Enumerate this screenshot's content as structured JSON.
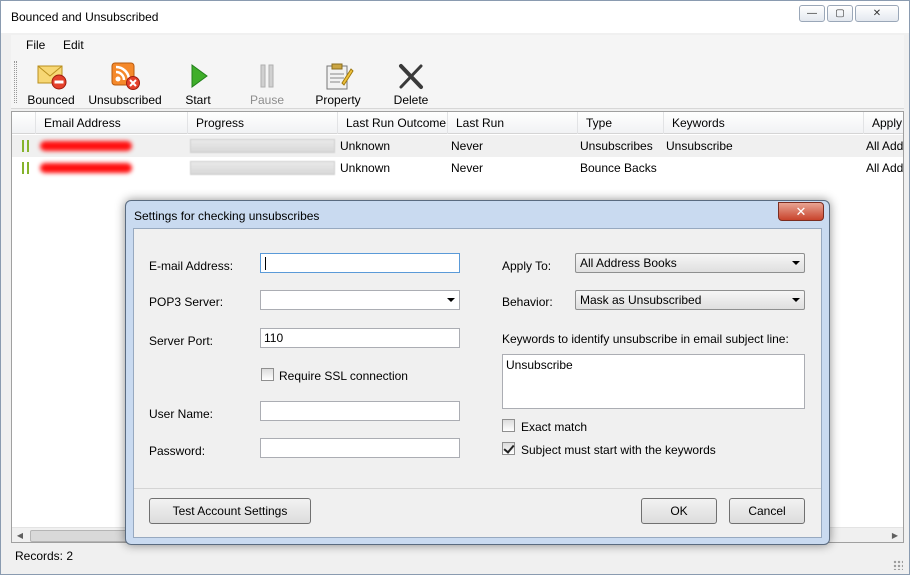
{
  "window": {
    "title": "Bounced and Unsubscribed",
    "minimize_glyph": "—",
    "maximize_glyph": "▢",
    "close_glyph": "✕"
  },
  "menu": {
    "file": "File",
    "edit": "Edit"
  },
  "toolbar": {
    "bounced": "Bounced",
    "unsubscribed": "Unsubscribed",
    "start": "Start",
    "pause": "Pause",
    "property": "Property",
    "delete": "Delete"
  },
  "grid": {
    "columns": [
      "Email Address",
      "Progress",
      "Last Run Outcome",
      "Last Run",
      "Type",
      "Keywords",
      "Apply"
    ],
    "rows": [
      {
        "outcome": "Unknown",
        "last_run": "Never",
        "type": "Unsubscribes",
        "keywords": "Unsubscribe",
        "apply": "All Add"
      },
      {
        "outcome": "Unknown",
        "last_run": "Never",
        "type": "Bounce Backs",
        "keywords": "",
        "apply": "All Add"
      }
    ]
  },
  "status": {
    "records": "Records: 2"
  },
  "dialog": {
    "title": "Settings for checking unsubscribes",
    "close_glyph": "✕",
    "email_label": "E-mail Address:",
    "email_value": "",
    "pop3_label": "POP3 Server:",
    "pop3_value": "",
    "port_label": "Server Port:",
    "port_value": "110",
    "ssl_label": "Require SSL connection",
    "ssl_checked": false,
    "username_label": "User Name:",
    "username_value": "",
    "password_label": "Password:",
    "password_value": "",
    "apply_label": "Apply To:",
    "apply_value": "All Address Books",
    "behavior_label": "Behavior:",
    "behavior_value": "Mask as Unsubscribed",
    "keywords_label": "Keywords to identify unsubscribe in email subject line:",
    "keywords_value": "Unsubscribe",
    "exact_label": "Exact match",
    "exact_checked": false,
    "subject_label": "Subject must start with the keywords",
    "subject_checked": true,
    "test_button": "Test Account Settings",
    "ok_button": "OK",
    "cancel_button": "Cancel"
  }
}
